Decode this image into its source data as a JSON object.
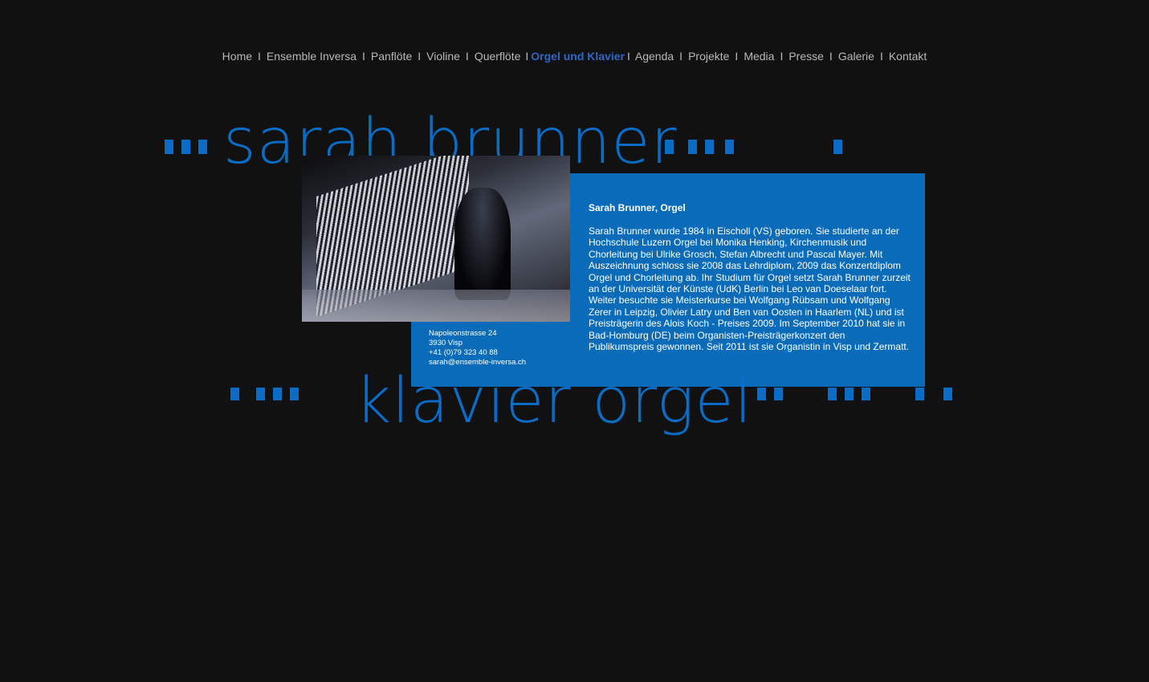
{
  "nav": {
    "items": [
      {
        "label": "Home"
      },
      {
        "label": "Ensemble Inversa"
      },
      {
        "label": "Panflöte"
      },
      {
        "label": "Violine"
      },
      {
        "label": "Querflöte"
      },
      {
        "label": "Orgel und Klavier",
        "active": true
      },
      {
        "label": "Agenda"
      },
      {
        "label": "Projekte"
      },
      {
        "label": "Media"
      },
      {
        "label": "Presse"
      },
      {
        "label": "Galerie"
      },
      {
        "label": "Kontakt"
      }
    ],
    "separator": "I"
  },
  "banner": {
    "top_text": "sarah brunner",
    "bottom_text": "klavier orgel",
    "color": "#0a6cc4"
  },
  "photo": {
    "alt": "Sarah Brunner an der Orgel"
  },
  "bio": {
    "title": "Sarah Brunner, Orgel",
    "text": "Sarah Brunner wurde 1984 in Eischoll (VS) geboren. Sie studierte an der Hochschule Luzern Orgel bei Monika Henking, Kirchenmusik und Chorleitung bei Ulrike Grosch, Stefan Albrecht und Pascal Mayer. Mit Auszeichnung schloss sie 2008 das Lehrdiplom, 2009 das Konzertdiplom Orgel und Chorleitung ab. Ihr Studium für Orgel setzt Sarah Brunner zurzeit an der Universität der Künste (UdK) Berlin bei Leo van Doeselaar fort. Weiter besuchte sie Meisterkurse bei Wolfgang Rübsam und Wolfgang Zerer in Leipzig, Olivier Latry und Ben van Oosten in Haarlem (NL) und ist Preisträgerin des Alois Koch -  Preises 2009. Im September 2010 hat sie in Bad-Homburg (DE) beim Organisten-Preisträgerkonzert  den Publikumspreis gewonnen. Seit 2011 ist sie Organistin in Visp und Zermatt."
  },
  "contact": {
    "street": "Napoleonstrasse 24",
    "city": "3930 Visp",
    "phone": "+41 (0)79 323 40 88",
    "email": "sarah@ensemble-inversa.ch"
  },
  "colors": {
    "background": "#111112",
    "accent": "#0a6cb8",
    "nav_text": "#b8b8b8",
    "nav_active": "#2f67c3"
  }
}
